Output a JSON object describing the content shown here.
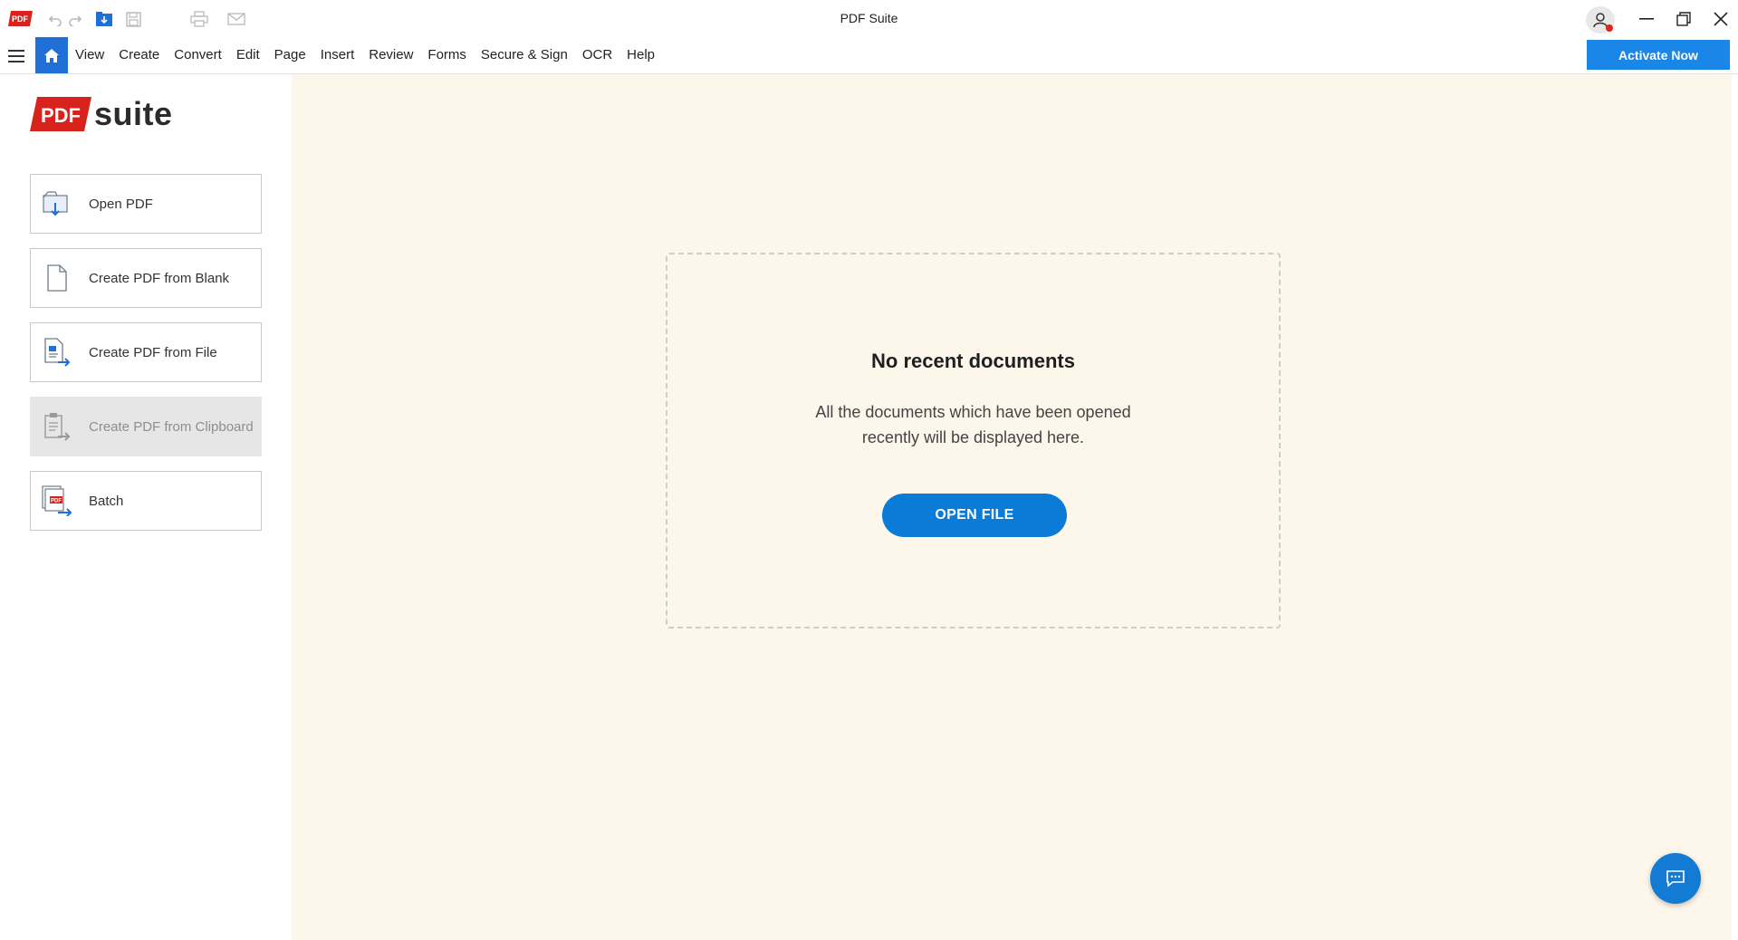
{
  "window": {
    "title": "PDF Suite",
    "logo_text": "PDF"
  },
  "quick_access": [
    {
      "name": "undo-icon"
    },
    {
      "name": "redo-icon"
    },
    {
      "name": "open-folder-icon"
    },
    {
      "name": "save-icon"
    },
    {
      "name": "print-icon"
    },
    {
      "name": "email-icon"
    }
  ],
  "menu": {
    "items": [
      "View",
      "Create",
      "Convert",
      "Edit",
      "Page",
      "Insert",
      "Review",
      "Forms",
      "Secure & Sign",
      "OCR",
      "Help"
    ],
    "activate_label": "Activate Now"
  },
  "brand": {
    "badge": "PDF",
    "word": "suite"
  },
  "actions": [
    {
      "label": "Open PDF",
      "icon": "open-pdf-icon",
      "disabled": false
    },
    {
      "label": "Create PDF from Blank",
      "icon": "blank-page-icon",
      "disabled": false
    },
    {
      "label": "Create PDF from File",
      "icon": "file-convert-icon",
      "disabled": false
    },
    {
      "label": "Create PDF from Clipboard",
      "icon": "clipboard-icon",
      "disabled": true
    },
    {
      "label": "Batch",
      "icon": "batch-icon",
      "disabled": false
    }
  ],
  "recent": {
    "title": "No recent documents",
    "description_line1": "All the documents which have been opened",
    "description_line2": "recently will be displayed here.",
    "open_file_label": "OPEN FILE"
  },
  "colors": {
    "accent": "#1a86e8",
    "home_tab": "#1f6fd6",
    "main_bg": "#fdf6ea",
    "brand_red": "#d8231c"
  }
}
